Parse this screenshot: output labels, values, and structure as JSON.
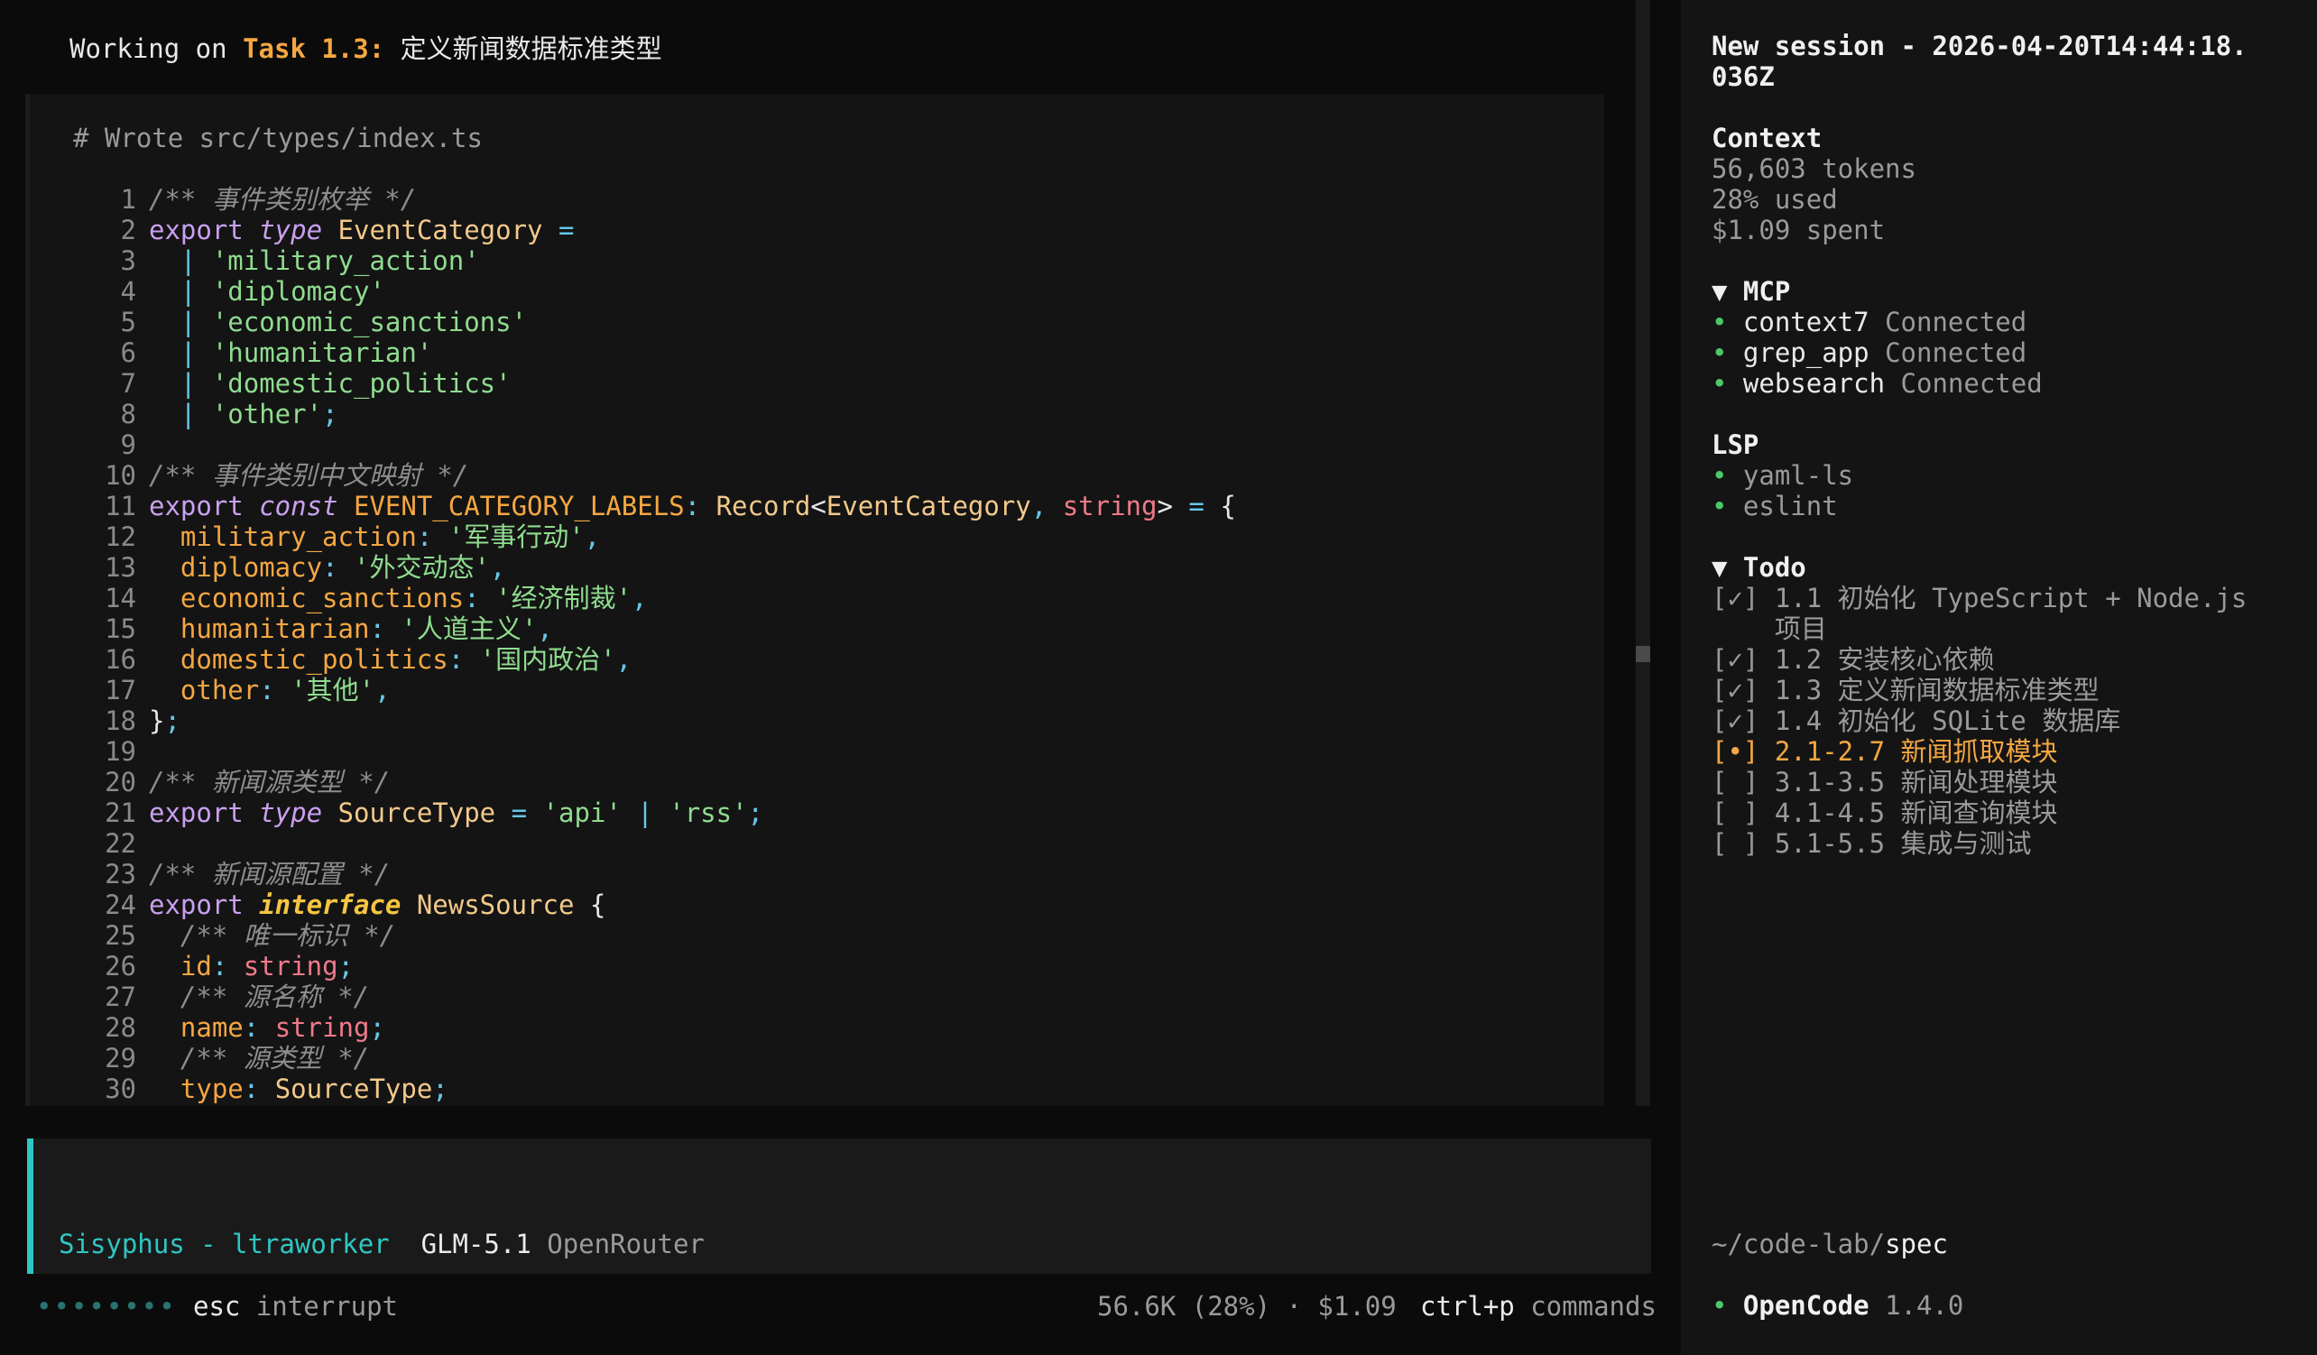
{
  "header": {
    "prefix": "Working on ",
    "task_label": "Task 1.3:",
    "task_title": " 定义新闻数据标准类型"
  },
  "editor": {
    "title": "# Wrote src/types/index.ts",
    "lines": [
      {
        "n": "1",
        "t": [
          [
            "com",
            "/** 事件类别枚举 */"
          ]
        ]
      },
      {
        "n": "2",
        "t": [
          [
            "kw",
            "export "
          ],
          [
            "kwi",
            "type "
          ],
          [
            "ty",
            "EventCategory"
          ],
          [
            "pun",
            " ="
          ]
        ]
      },
      {
        "n": "3",
        "t": [
          [
            "pun",
            "  | "
          ],
          [
            "str",
            "'military_action'"
          ]
        ]
      },
      {
        "n": "4",
        "t": [
          [
            "pun",
            "  | "
          ],
          [
            "str",
            "'diplomacy'"
          ]
        ]
      },
      {
        "n": "5",
        "t": [
          [
            "pun",
            "  | "
          ],
          [
            "str",
            "'economic_sanctions'"
          ]
        ]
      },
      {
        "n": "6",
        "t": [
          [
            "pun",
            "  | "
          ],
          [
            "str",
            "'humanitarian'"
          ]
        ]
      },
      {
        "n": "7",
        "t": [
          [
            "pun",
            "  | "
          ],
          [
            "str",
            "'domestic_politics'"
          ]
        ]
      },
      {
        "n": "8",
        "t": [
          [
            "pun",
            "  | "
          ],
          [
            "str",
            "'other'"
          ],
          [
            "pun",
            ";"
          ]
        ]
      },
      {
        "n": "9",
        "t": []
      },
      {
        "n": "10",
        "t": [
          [
            "com",
            "/** 事件类别中文映射 */"
          ]
        ]
      },
      {
        "n": "11",
        "t": [
          [
            "kw",
            "export "
          ],
          [
            "kwi",
            "const "
          ],
          [
            "id",
            "EVENT_CATEGORY_LABELS"
          ],
          [
            "pun",
            ": "
          ],
          [
            "ty",
            "Record"
          ],
          [
            "pl",
            "<"
          ],
          [
            "ty",
            "EventCategory"
          ],
          [
            "pun",
            ", "
          ],
          [
            "red",
            "string"
          ],
          [
            "pl",
            ">"
          ],
          [
            "pun",
            " = "
          ],
          [
            "pl",
            "{"
          ]
        ]
      },
      {
        "n": "12",
        "t": [
          [
            "id",
            "  military_action"
          ],
          [
            "pun",
            ": "
          ],
          [
            "str",
            "'军事行动'"
          ],
          [
            "pun",
            ","
          ]
        ]
      },
      {
        "n": "13",
        "t": [
          [
            "id",
            "  diplomacy"
          ],
          [
            "pun",
            ": "
          ],
          [
            "str",
            "'外交动态'"
          ],
          [
            "pun",
            ","
          ]
        ]
      },
      {
        "n": "14",
        "t": [
          [
            "id",
            "  economic_sanctions"
          ],
          [
            "pun",
            ": "
          ],
          [
            "str",
            "'经济制裁'"
          ],
          [
            "pun",
            ","
          ]
        ]
      },
      {
        "n": "15",
        "t": [
          [
            "id",
            "  humanitarian"
          ],
          [
            "pun",
            ": "
          ],
          [
            "str",
            "'人道主义'"
          ],
          [
            "pun",
            ","
          ]
        ]
      },
      {
        "n": "16",
        "t": [
          [
            "id",
            "  domestic_politics"
          ],
          [
            "pun",
            ": "
          ],
          [
            "str",
            "'国内政治'"
          ],
          [
            "pun",
            ","
          ]
        ]
      },
      {
        "n": "17",
        "t": [
          [
            "id",
            "  other"
          ],
          [
            "pun",
            ": "
          ],
          [
            "str",
            "'其他'"
          ],
          [
            "pun",
            ","
          ]
        ]
      },
      {
        "n": "18",
        "t": [
          [
            "pl",
            "}"
          ],
          [
            "pun",
            ";"
          ]
        ]
      },
      {
        "n": "19",
        "t": []
      },
      {
        "n": "20",
        "t": [
          [
            "com",
            "/** 新闻源类型 */"
          ]
        ]
      },
      {
        "n": "21",
        "t": [
          [
            "kw",
            "export "
          ],
          [
            "kwi",
            "type "
          ],
          [
            "ty",
            "SourceType"
          ],
          [
            "pun",
            " = "
          ],
          [
            "str",
            "'api'"
          ],
          [
            "pun",
            " | "
          ],
          [
            "str",
            "'rss'"
          ],
          [
            "pun",
            ";"
          ]
        ]
      },
      {
        "n": "22",
        "t": []
      },
      {
        "n": "23",
        "t": [
          [
            "com",
            "/** 新闻源配置 */"
          ]
        ]
      },
      {
        "n": "24",
        "t": [
          [
            "kw",
            "export "
          ],
          [
            "kwb",
            "interface "
          ],
          [
            "ty",
            "NewsSource"
          ],
          [
            "pl",
            " {"
          ]
        ]
      },
      {
        "n": "25",
        "t": [
          [
            "com",
            "  /** 唯一标识 */"
          ]
        ]
      },
      {
        "n": "26",
        "t": [
          [
            "id",
            "  id"
          ],
          [
            "pun",
            ": "
          ],
          [
            "red",
            "string"
          ],
          [
            "pun",
            ";"
          ]
        ]
      },
      {
        "n": "27",
        "t": [
          [
            "com",
            "  /** 源名称 */"
          ]
        ]
      },
      {
        "n": "28",
        "t": [
          [
            "id",
            "  name"
          ],
          [
            "pun",
            ": "
          ],
          [
            "red",
            "string"
          ],
          [
            "pun",
            ";"
          ]
        ]
      },
      {
        "n": "29",
        "t": [
          [
            "com",
            "  /** 源类型 */"
          ]
        ]
      },
      {
        "n": "30",
        "t": [
          [
            "id",
            "  type"
          ],
          [
            "pun",
            ": "
          ],
          [
            "ty",
            "SourceType"
          ],
          [
            "pun",
            ";"
          ]
        ]
      }
    ]
  },
  "agent": {
    "name": "Sisyphus - ltraworker",
    "model": "GLM-5.1",
    "provider": "OpenRouter"
  },
  "status": {
    "dots": "••••••••",
    "esc_key": "esc",
    "esc_label": " interrupt",
    "usage": "56.6K (28%) · $1.09",
    "cmd_key": "ctrl+p",
    "cmd_label": " commands"
  },
  "sidebar": {
    "session_line1": "New session - 2026-04-20T14:44:18.",
    "session_line2": "036Z",
    "context": {
      "title": "Context",
      "tokens": "56,603 tokens",
      "used": "28% used",
      "spent": "$1.09 spent"
    },
    "mcp": {
      "title": "▼ MCP",
      "items": [
        {
          "name": "context7",
          "status": " Connected"
        },
        {
          "name": "grep_app",
          "status": " Connected"
        },
        {
          "name": "websearch",
          "status": " Connected"
        }
      ]
    },
    "lsp": {
      "title": "LSP",
      "items": [
        "yaml-ls",
        "eslint"
      ]
    },
    "todo": {
      "title": "▼ Todo",
      "items": [
        {
          "text": "[✓] 1.1 初始化 TypeScript + Node.js",
          "state": "done"
        },
        {
          "text": "    项目",
          "state": "done"
        },
        {
          "text": "[✓] 1.2 安装核心依赖",
          "state": "done"
        },
        {
          "text": "[✓] 1.3 定义新闻数据标准类型",
          "state": "done"
        },
        {
          "text": "[✓] 1.4 初始化 SQLite 数据库",
          "state": "done"
        },
        {
          "text": "[•] 2.1-2.7 新闻抓取模块",
          "state": "active"
        },
        {
          "text": "[ ] 3.1-3.5 新闻处理模块",
          "state": "pend"
        },
        {
          "text": "[ ] 4.1-4.5 新闻查询模块",
          "state": "pend"
        },
        {
          "text": "[ ] 5.1-5.5 集成与测试",
          "state": "pend"
        }
      ]
    },
    "cwd_prefix": "~/code-lab/",
    "cwd_dir": "spec",
    "app_name": "OpenCode",
    "app_version": " 1.4.0"
  }
}
